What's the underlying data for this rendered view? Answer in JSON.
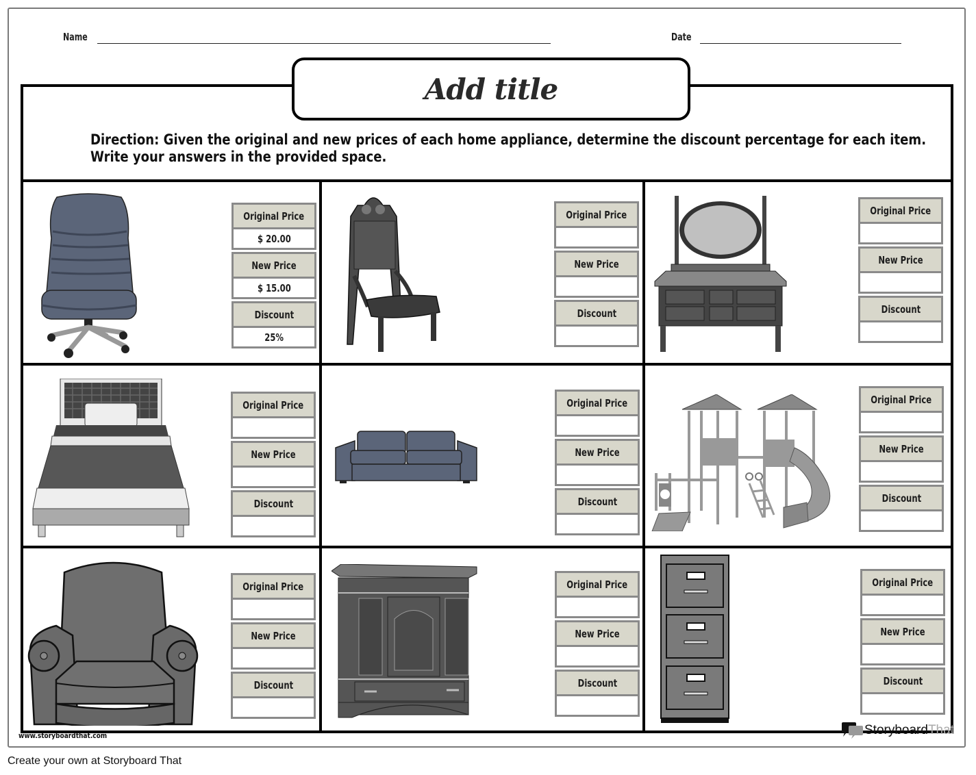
{
  "header": {
    "name_label": "Name",
    "date_label": "Date"
  },
  "title": "Add title",
  "direction": {
    "line1": "Direction: Given the original and new prices of each home appliance, determine the discount percentage for each item.",
    "line2": "Write your answers in the provided space."
  },
  "labels": {
    "original": "Original Price",
    "new": "New Price",
    "discount": "Discount"
  },
  "items": [
    {
      "name": "Office Chair",
      "icon": "office-chair-icon",
      "original_price": "$ 20.00",
      "new_price": "$ 15.00",
      "discount": "25%"
    },
    {
      "name": "Antique Chair",
      "icon": "antique-chair-icon",
      "original_price": "",
      "new_price": "",
      "discount": ""
    },
    {
      "name": "Vanity Dresser",
      "icon": "vanity-dresser-icon",
      "original_price": "",
      "new_price": "",
      "discount": ""
    },
    {
      "name": "Bed",
      "icon": "bed-icon",
      "original_price": "",
      "new_price": "",
      "discount": ""
    },
    {
      "name": "Sofa",
      "icon": "sofa-icon",
      "original_price": "",
      "new_price": "",
      "discount": ""
    },
    {
      "name": "Playground Set",
      "icon": "playground-icon",
      "original_price": "",
      "new_price": "",
      "discount": ""
    },
    {
      "name": "Armchair",
      "icon": "armchair-icon",
      "original_price": "",
      "new_price": "",
      "discount": ""
    },
    {
      "name": "Armoire",
      "icon": "armoire-icon",
      "original_price": "",
      "new_price": "",
      "discount": ""
    },
    {
      "name": "Filing Cabinet",
      "icon": "filing-cabinet-icon",
      "original_price": "",
      "new_price": "",
      "discount": ""
    }
  ],
  "watermark": {
    "url": "www.storyboardthat.com",
    "logo_part1": "Storyboard",
    "logo_part2": "That"
  },
  "footer": "Create your own at Storyboard That",
  "colors": {
    "label_bg": "#d8d7cb",
    "box_border": "#8a8a8a",
    "furniture_blue": "#5b6579"
  }
}
